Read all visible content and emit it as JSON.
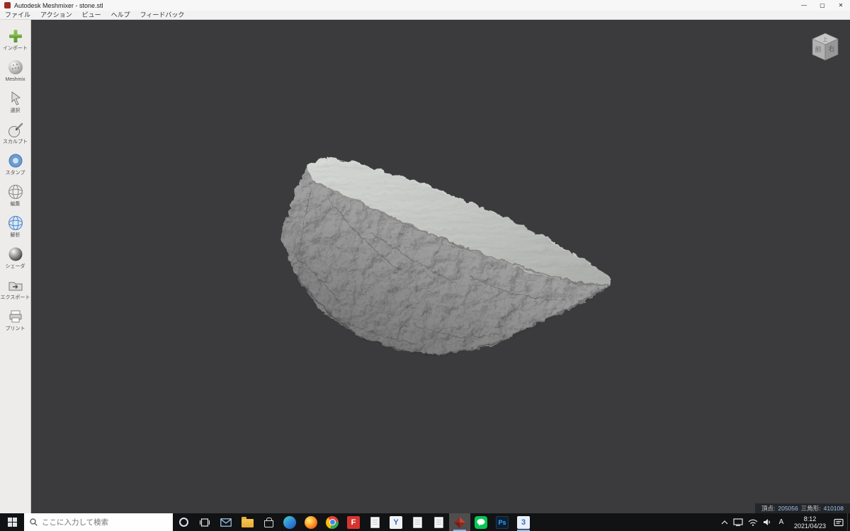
{
  "window": {
    "title": "Autodesk Meshmixer - stone.stl",
    "controls": {
      "minimize": "—",
      "maximize": "▢",
      "close": "✕"
    }
  },
  "menubar": {
    "items": [
      {
        "label": "ファイル"
      },
      {
        "label": "アクション"
      },
      {
        "label": "ビュー"
      },
      {
        "label": "ヘルプ"
      },
      {
        "label": "フィードバック"
      }
    ]
  },
  "toolbar": {
    "items": [
      {
        "label": "インポート"
      },
      {
        "label": "Meshmix"
      },
      {
        "label": "選択"
      },
      {
        "label": "スカルプト"
      },
      {
        "label": "スタンプ"
      },
      {
        "label": "編集"
      },
      {
        "label": "解析"
      },
      {
        "label": "シェーダ"
      },
      {
        "label": "エクスポート"
      },
      {
        "label": "プリント"
      }
    ]
  },
  "viewport": {
    "viewcube": {
      "top": "上",
      "front": "前",
      "right": "右"
    },
    "status": {
      "vertices_label": "頂点:",
      "vertices_value": "205056",
      "triangles_label": "三角形:",
      "triangles_value": "410108"
    }
  },
  "taskbar": {
    "search_placeholder": "ここに入力して検索",
    "apps": {
      "f_app": "F",
      "y_app": "Y",
      "photoshop": "Ps",
      "three_app": "3"
    },
    "tray": {
      "ime": "A",
      "time": "8:12",
      "date": "2021/04/23"
    }
  },
  "colors": {
    "viewport_background": "#3b3b3d",
    "taskbar_accent": "#76b9ed",
    "line_green": "#06c755",
    "photoshop_blue": "#31a8ff"
  }
}
